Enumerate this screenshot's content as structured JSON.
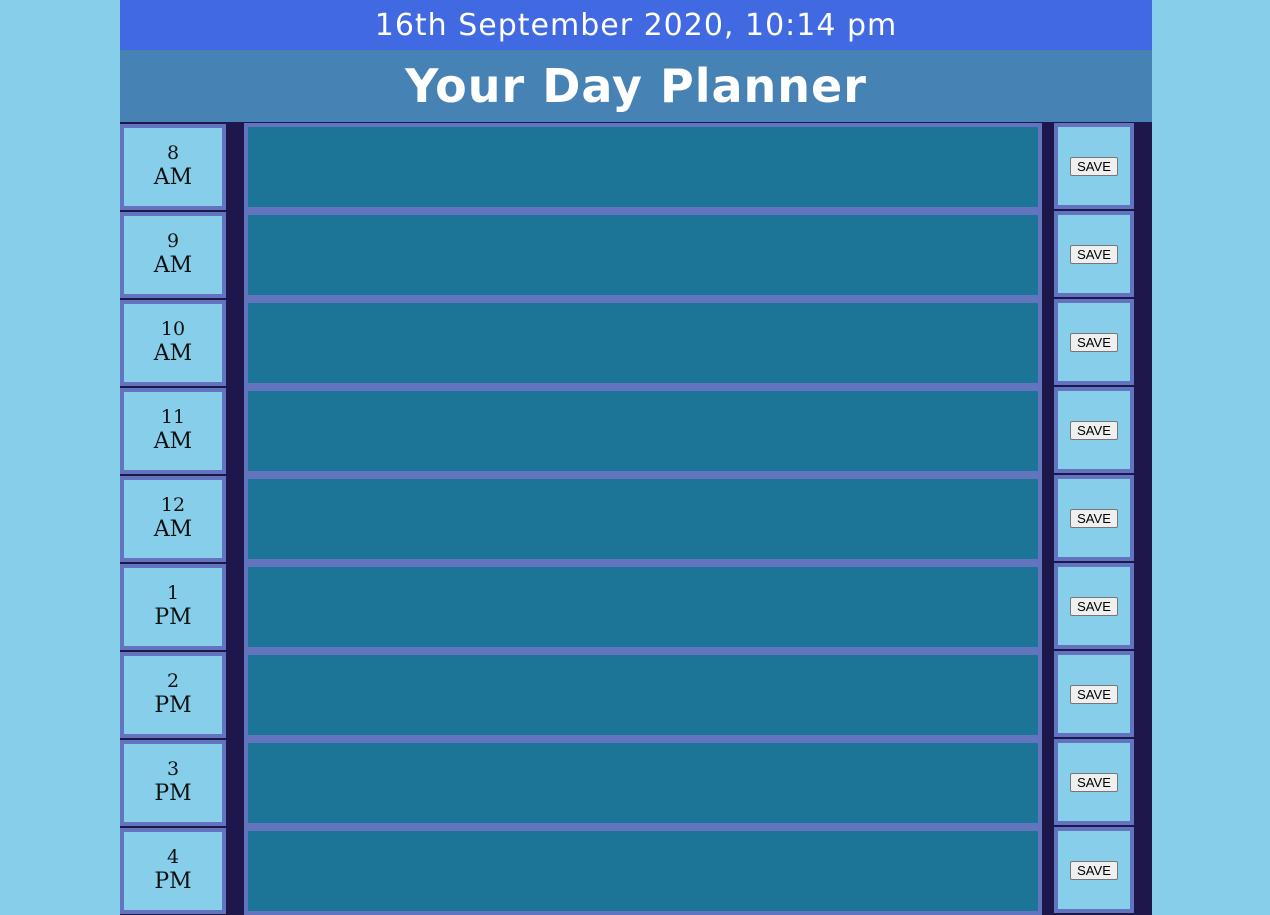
{
  "header": {
    "date": "16th September 2020, 10:14 pm",
    "title": "Your Day Planner"
  },
  "rows": [
    {
      "hour": "8",
      "period": "AM",
      "task": "",
      "save_label": "SAVE"
    },
    {
      "hour": "9",
      "period": "AM",
      "task": "",
      "save_label": "SAVE"
    },
    {
      "hour": "10",
      "period": "AM",
      "task": "",
      "save_label": "SAVE"
    },
    {
      "hour": "11",
      "period": "AM",
      "task": "",
      "save_label": "SAVE"
    },
    {
      "hour": "12",
      "period": "AM",
      "task": "",
      "save_label": "SAVE"
    },
    {
      "hour": "1",
      "period": "PM",
      "task": "",
      "save_label": "SAVE"
    },
    {
      "hour": "2",
      "period": "PM",
      "task": "",
      "save_label": "SAVE"
    },
    {
      "hour": "3",
      "period": "PM",
      "task": "",
      "save_label": "SAVE"
    },
    {
      "hour": "4",
      "period": "PM",
      "task": "",
      "save_label": "SAVE"
    }
  ],
  "colors": {
    "page_background": "#87ceeb",
    "date_bar": "#4169e1",
    "title_bar": "#4682b4",
    "planner_background": "#1e174b",
    "task_field": "#1c7496",
    "cell_border": "#6274be"
  }
}
